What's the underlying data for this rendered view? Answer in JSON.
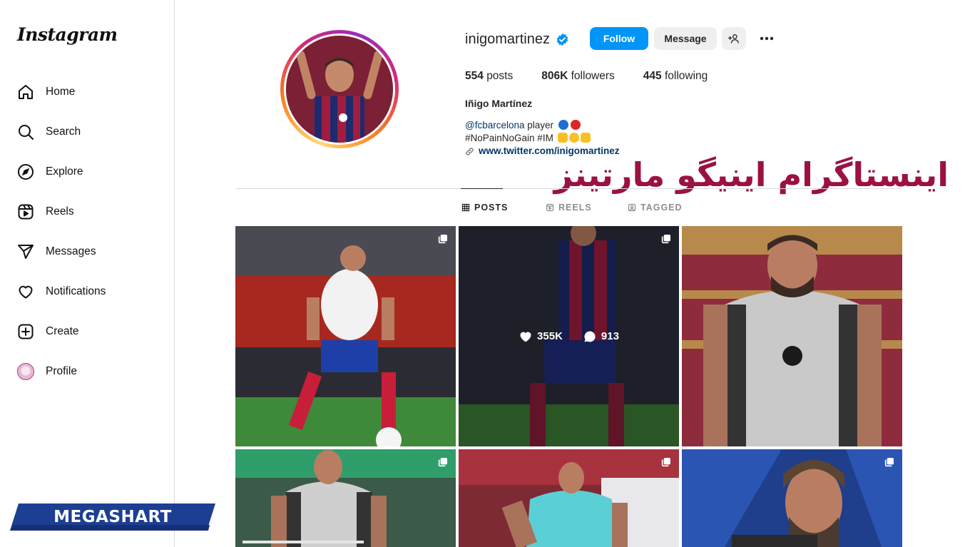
{
  "sidebar": {
    "logo": "Instagram",
    "items": [
      {
        "label": "Home",
        "icon": "home-icon"
      },
      {
        "label": "Search",
        "icon": "search-icon"
      },
      {
        "label": "Explore",
        "icon": "compass-icon"
      },
      {
        "label": "Reels",
        "icon": "reels-icon"
      },
      {
        "label": "Messages",
        "icon": "send-icon"
      },
      {
        "label": "Notifications",
        "icon": "heart-icon"
      },
      {
        "label": "Create",
        "icon": "plus-square-icon"
      },
      {
        "label": "Profile",
        "icon": "avatar-icon"
      }
    ]
  },
  "watermark": {
    "brand": "MEGASHART",
    "persian_title": "اینستاگرام اینیگو مارتینز"
  },
  "profile": {
    "username": "inigomartinez",
    "verified": true,
    "follow_label": "Follow",
    "message_label": "Message",
    "stats": {
      "posts_count": "554",
      "posts_label": "posts",
      "followers_count": "806K",
      "followers_label": "followers",
      "following_count": "445",
      "following_label": "following"
    },
    "full_name": "Iñigo Martínez",
    "bio": {
      "mention": "@fcbarcelona",
      "line1_text": "player",
      "line2": "#NoPainNoGain #IM",
      "link": "www.twitter.com/inigomartinez"
    }
  },
  "tabs": [
    {
      "label": "POSTS",
      "icon": "grid-icon",
      "active": true
    },
    {
      "label": "REELS",
      "icon": "reels-icon",
      "active": false
    },
    {
      "label": "TAGGED",
      "icon": "tagged-icon",
      "active": false
    }
  ],
  "hover_stats": {
    "likes": "355K",
    "comments": "913"
  },
  "colors": {
    "accent": "#0095f6",
    "persian_title": "#9b1143",
    "megashart_blue": "#1d3f93"
  }
}
